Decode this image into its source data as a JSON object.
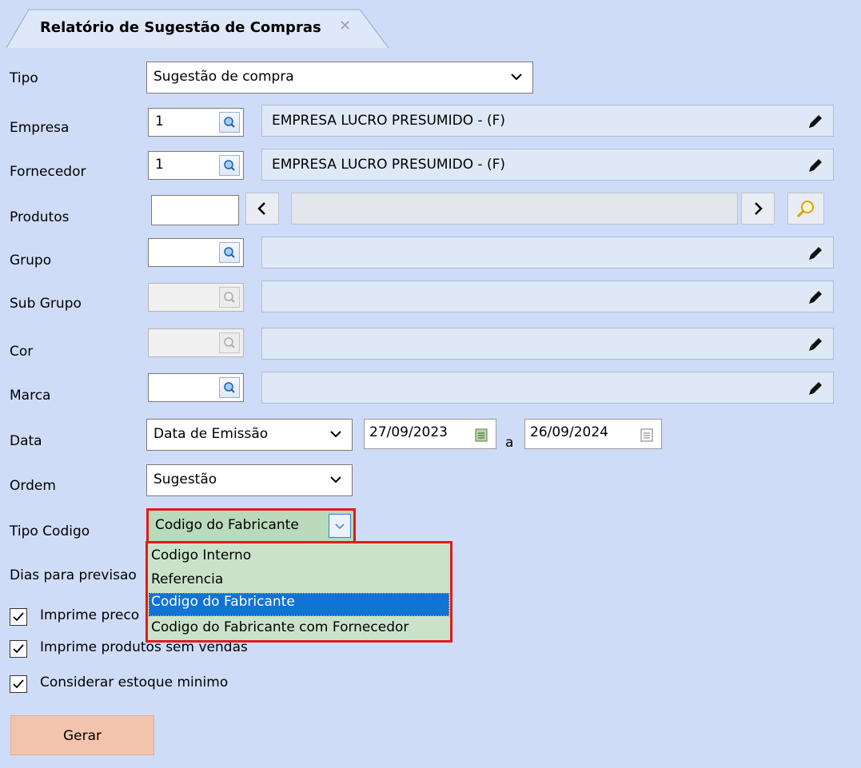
{
  "tab": {
    "title": "Relatório de Sugestão de Compras",
    "close": "✕"
  },
  "labels": {
    "tipo": "Tipo",
    "empresa": "Empresa",
    "fornecedor": "Fornecedor",
    "produtos": "Produtos",
    "grupo": "Grupo",
    "subgrupo": "Sub Grupo",
    "cor": "Cor",
    "marca": "Marca",
    "data": "Data",
    "ordem": "Ordem",
    "tipo_codigo": "Tipo Codigo",
    "dias": "Dias para previsao"
  },
  "fields": {
    "tipo_value": "Sugestão de compra",
    "empresa_code": "1",
    "empresa_desc": "EMPRESA LUCRO PRESUMIDO - (F)",
    "fornecedor_code": "1",
    "fornecedor_desc": "EMPRESA LUCRO PRESUMIDO - (F)",
    "data_type": "Data de Emissão",
    "date_from": "27/09/2023",
    "date_sep": "a",
    "date_to": "26/09/2024",
    "ordem_value": "Sugestão",
    "tipo_codigo_value": "Codigo do Fabricante"
  },
  "dropdown": {
    "options": [
      "Codigo Interno",
      "Referencia",
      "Codigo do Fabricante",
      "Codigo do Fabricante com Fornecedor"
    ],
    "selected_index": 2
  },
  "checkboxes": [
    {
      "label": "Imprime preco",
      "checked": true
    },
    {
      "label": "Imprime produtos sem vendas",
      "checked": true
    },
    {
      "label": "Considerar estoque minimo",
      "checked": true
    }
  ],
  "button": {
    "generate": "Gerar"
  },
  "colors": {
    "background": "#cfdcf7",
    "highlight": "#e11b1b",
    "selected": "#0f74d6",
    "button": "#f2c4ae"
  }
}
